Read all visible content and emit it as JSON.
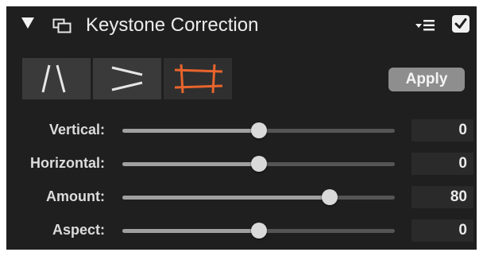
{
  "panel": {
    "title": "Keystone Correction",
    "enabled": true
  },
  "modes": [
    {
      "name": "vertical-mode",
      "icon": "vertical-keystone-icon",
      "selected": false
    },
    {
      "name": "horizontal-mode",
      "icon": "horizontal-keystone-icon",
      "selected": false
    },
    {
      "name": "crop-mode",
      "icon": "crop-keystone-icon",
      "selected": true
    }
  ],
  "apply_label": "Apply",
  "sliders": [
    {
      "label": "Vertical:",
      "value": "0",
      "level": 0.5
    },
    {
      "label": "Horizontal:",
      "value": "0",
      "level": 0.5
    },
    {
      "label": "Amount:",
      "value": "80",
      "level": 0.76
    },
    {
      "label": "Aspect:",
      "value": "0",
      "level": 0.5
    }
  ],
  "colors": {
    "accent": "#e8642c",
    "panel_bg": "#1f1f1f"
  }
}
